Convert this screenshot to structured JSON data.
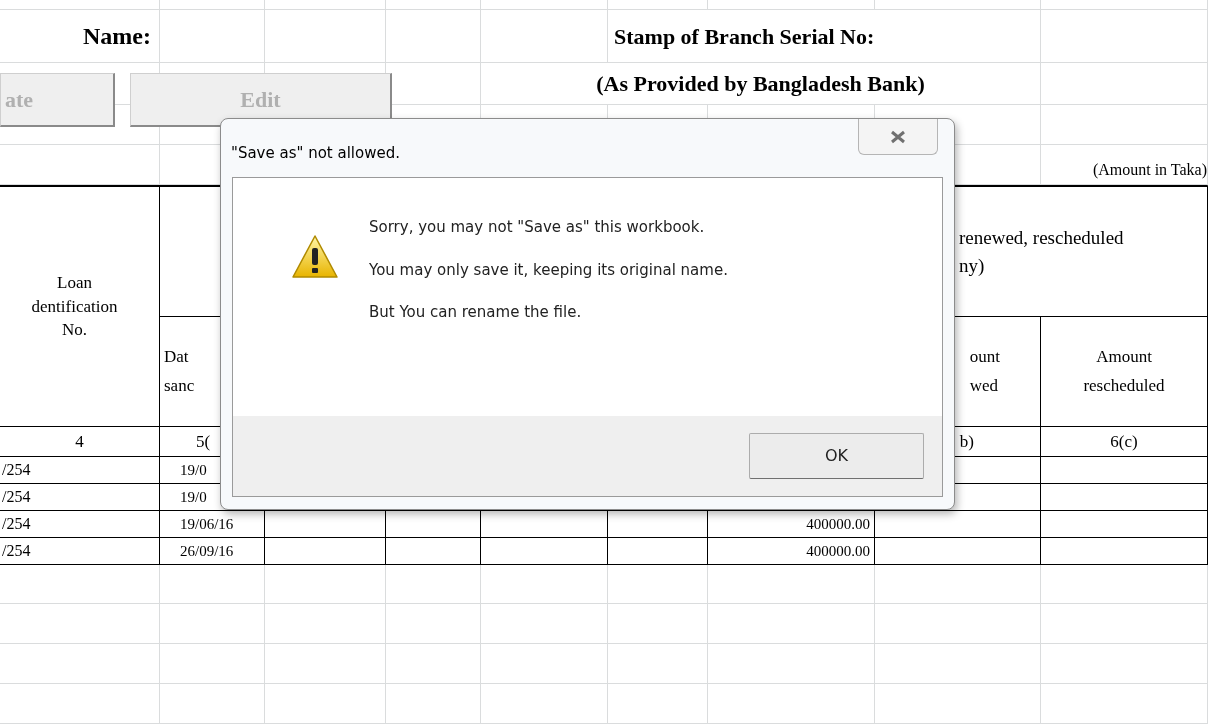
{
  "sheet": {
    "name_label": "Name:",
    "stamp_label": "Stamp of Branch Serial No:",
    "buttons": [
      {
        "label": "ate",
        "disabled": true
      },
      {
        "label": "Edit",
        "disabled": true
      }
    ],
    "provided_note": "(As Provided by Bangladesh Bank)",
    "amount_note": "(Amount in Taka)",
    "table": {
      "header": {
        "loan_id": "Loan\ndentification\nNo.",
        "date_partial": "Dat\nsanc",
        "renewed_group": "renewed, rescheduled\nny)",
        "amount_renewed": "ount\nwed",
        "amount_rescheduled": "Amount\nrescheduled"
      },
      "numbers": [
        "4",
        "5(",
        "b)",
        "6(c)"
      ],
      "rows": [
        {
          "loan_id": "/254",
          "date": "19/0",
          "amount": ""
        },
        {
          "loan_id": "/254",
          "date": "19/0",
          "amount": ""
        },
        {
          "loan_id": "/254",
          "date": "19/06/16",
          "amount": "400000.00"
        },
        {
          "loan_id": "/254",
          "date": "26/09/16",
          "amount": "400000.00"
        }
      ]
    }
  },
  "dialog": {
    "title": "\"Save as\" not allowed.",
    "lines": [
      "Sorry, you may not \"Save as\" this workbook.",
      "You may only save it, keeping its original name.",
      "But You can rename the file."
    ],
    "ok_button": "OK"
  }
}
